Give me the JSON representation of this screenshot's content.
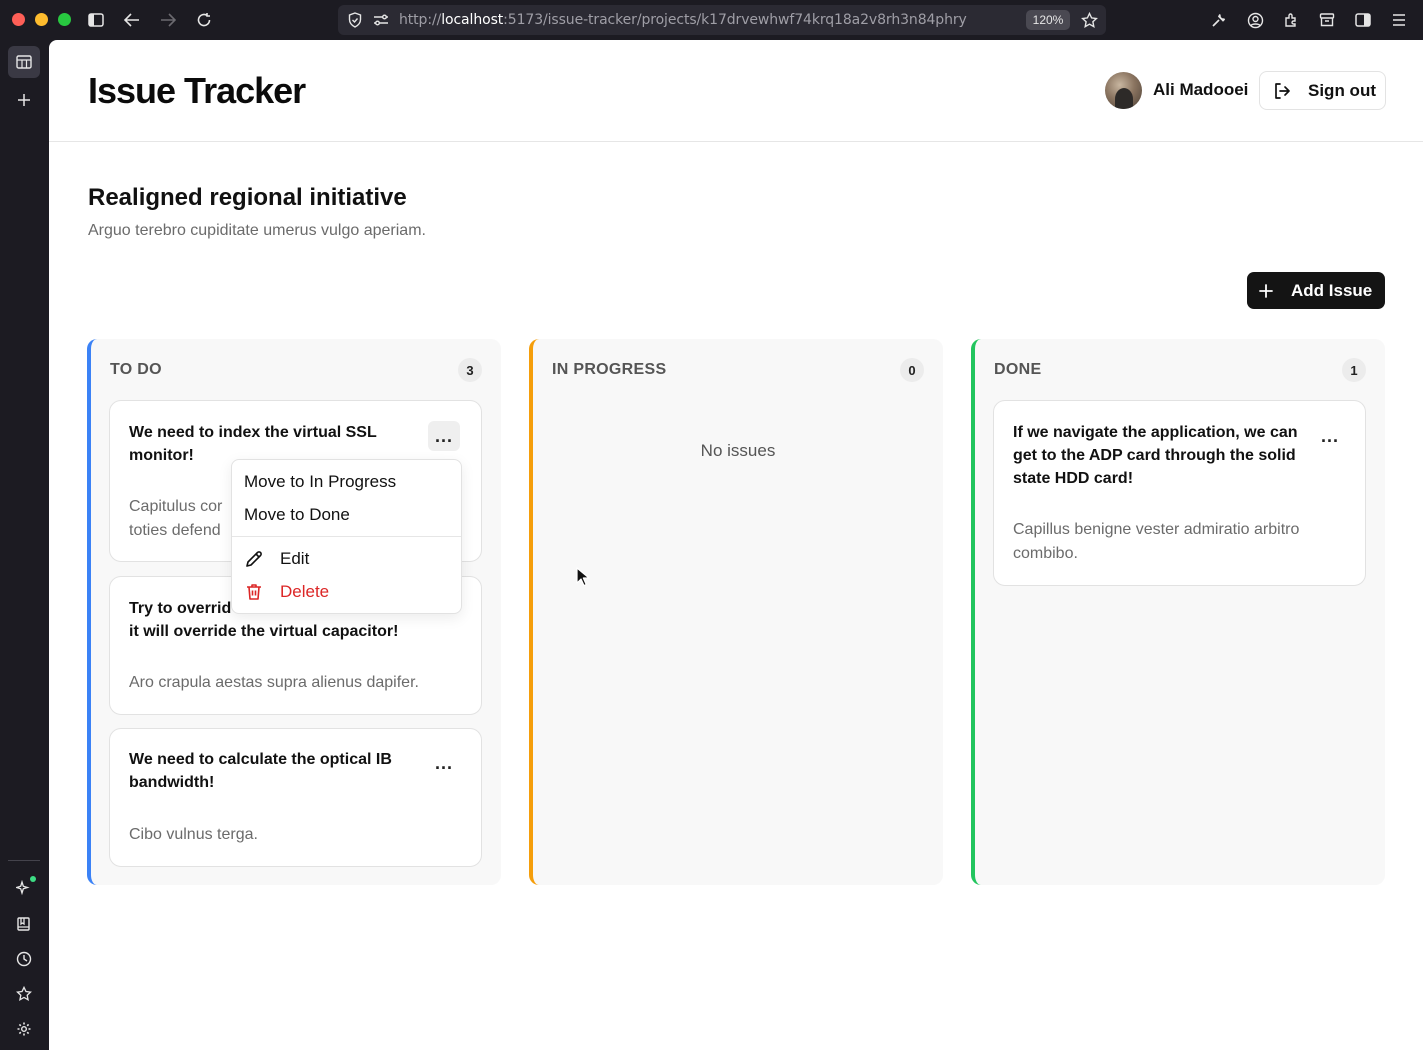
{
  "browser": {
    "url_scheme": "http://",
    "url_host": "localhost",
    "url_rest": ":5173/issue-tracker/projects/k17drvewhwf74krq18a2v8rh3n84phry",
    "zoom": "120%"
  },
  "header": {
    "app_title": "Issue Tracker",
    "user_name": "Ali Madooei",
    "sign_out_label": "Sign out"
  },
  "project": {
    "title": "Realigned regional initiative",
    "description": "Arguo terebro cupiditate umerus vulgo aperiam.",
    "add_issue_label": "Add Issue"
  },
  "columns": {
    "todo": {
      "title": "TO DO",
      "count": "3",
      "cards": [
        {
          "title": "We need to index the virtual SSL monitor!",
          "description": "Capitulus cor",
          "description_line2": "toties defend"
        },
        {
          "title_line1": "Try to overrid",
          "title_line2": "it will override the virtual capacitor!",
          "description": "Aro crapula aestas supra alienus dapifer."
        },
        {
          "title": "We need to calculate the optical IB bandwidth!",
          "description": "Cibo vulnus terga."
        }
      ]
    },
    "in_progress": {
      "title": "IN PROGRESS",
      "count": "0",
      "empty_message": "No issues"
    },
    "done": {
      "title": "DONE",
      "count": "1",
      "cards": [
        {
          "title": "If we navigate the application, we can get to the ADP card through the solid state HDD card!",
          "description": "Capillus benigne vester admiratio arbitro combibo."
        }
      ]
    }
  },
  "menu": {
    "move_in_progress": "Move to In Progress",
    "move_done": "Move to Done",
    "edit": "Edit",
    "delete": "Delete"
  },
  "menu_glyph": "...",
  "colors": {
    "todo_accent": "#3b82f6",
    "in_progress_accent": "#f59e0b",
    "done_accent": "#22c55e",
    "delete_red": "#dc2626"
  }
}
